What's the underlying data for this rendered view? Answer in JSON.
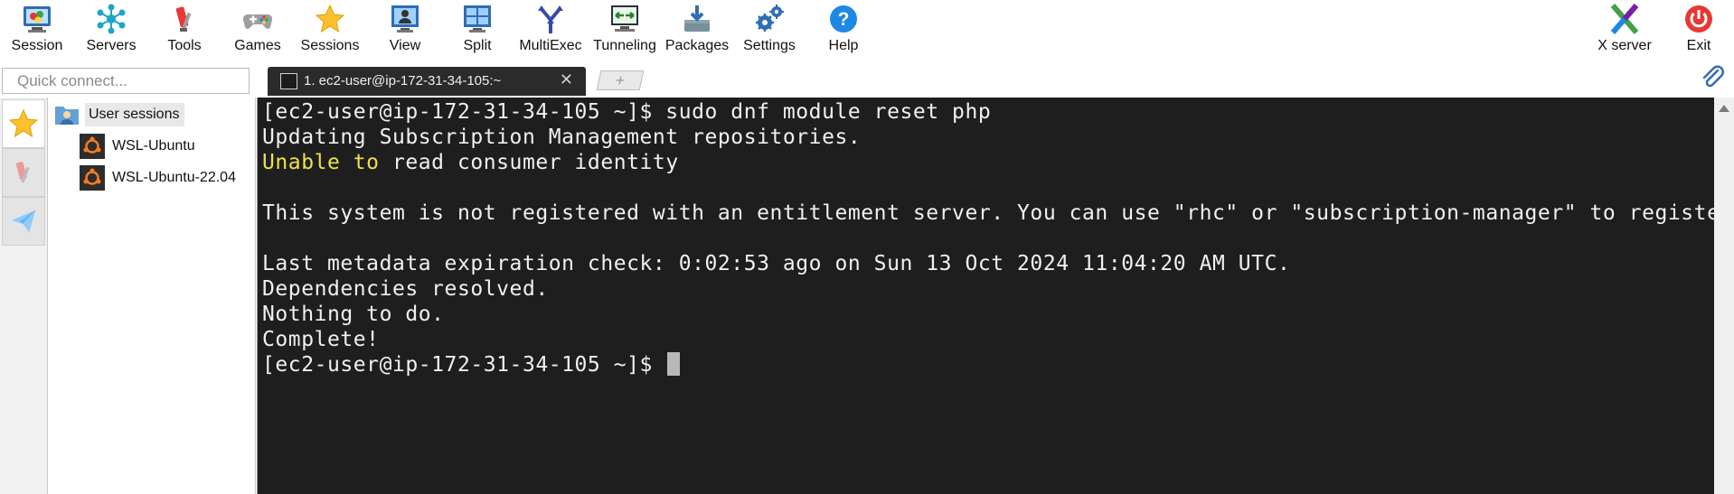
{
  "toolbar": {
    "items": [
      {
        "label": "Session",
        "icon": "session-icon"
      },
      {
        "label": "Servers",
        "icon": "servers-icon"
      },
      {
        "label": "Tools",
        "icon": "tools-icon"
      },
      {
        "label": "Games",
        "icon": "games-icon"
      },
      {
        "label": "Sessions",
        "icon": "sessions-star-icon"
      },
      {
        "label": "View",
        "icon": "view-icon"
      },
      {
        "label": "Split",
        "icon": "split-icon"
      },
      {
        "label": "MultiExec",
        "icon": "multiexec-icon"
      },
      {
        "label": "Tunneling",
        "icon": "tunneling-icon"
      },
      {
        "label": "Packages",
        "icon": "packages-icon"
      },
      {
        "label": "Settings",
        "icon": "settings-icon"
      },
      {
        "label": "Help",
        "icon": "help-icon"
      },
      {
        "label": "X server",
        "icon": "xserver-icon"
      },
      {
        "label": "Exit",
        "icon": "exit-icon"
      }
    ]
  },
  "quick_connect": {
    "placeholder": "Quick connect..."
  },
  "tab": {
    "label": "1. ec2-user@ip-172-31-34-105:~",
    "close": "✕"
  },
  "new_tab": {
    "label": "+"
  },
  "tree": {
    "root": "User sessions",
    "children": [
      "WSL-Ubuntu",
      "WSL-Ubuntu-22.04"
    ]
  },
  "terminal": {
    "lines": [
      "[ec2-user@ip-172-31-34-105 ~]$ sudo dnf module reset php",
      "Updating Subscription Management repositories.",
      "",
      "",
      "This system is not registered with an entitlement server. You can use \"rhc\" or \"subscription-manager\" to register.",
      "",
      "Last metadata expiration check: 0:02:53 ago on Sun 13 Oct 2024 11:04:20 AM UTC.",
      "Dependencies resolved.",
      "Nothing to do.",
      "Complete!",
      "[ec2-user@ip-172-31-34-105 ~]$ "
    ],
    "warning_prefix": "Unable to",
    "warning_rest": " read consumer identity"
  },
  "colors": {
    "terminal_bg": "#1e1e1e",
    "terminal_fg": "#f0f0f0",
    "warning": "#f0e04a"
  }
}
